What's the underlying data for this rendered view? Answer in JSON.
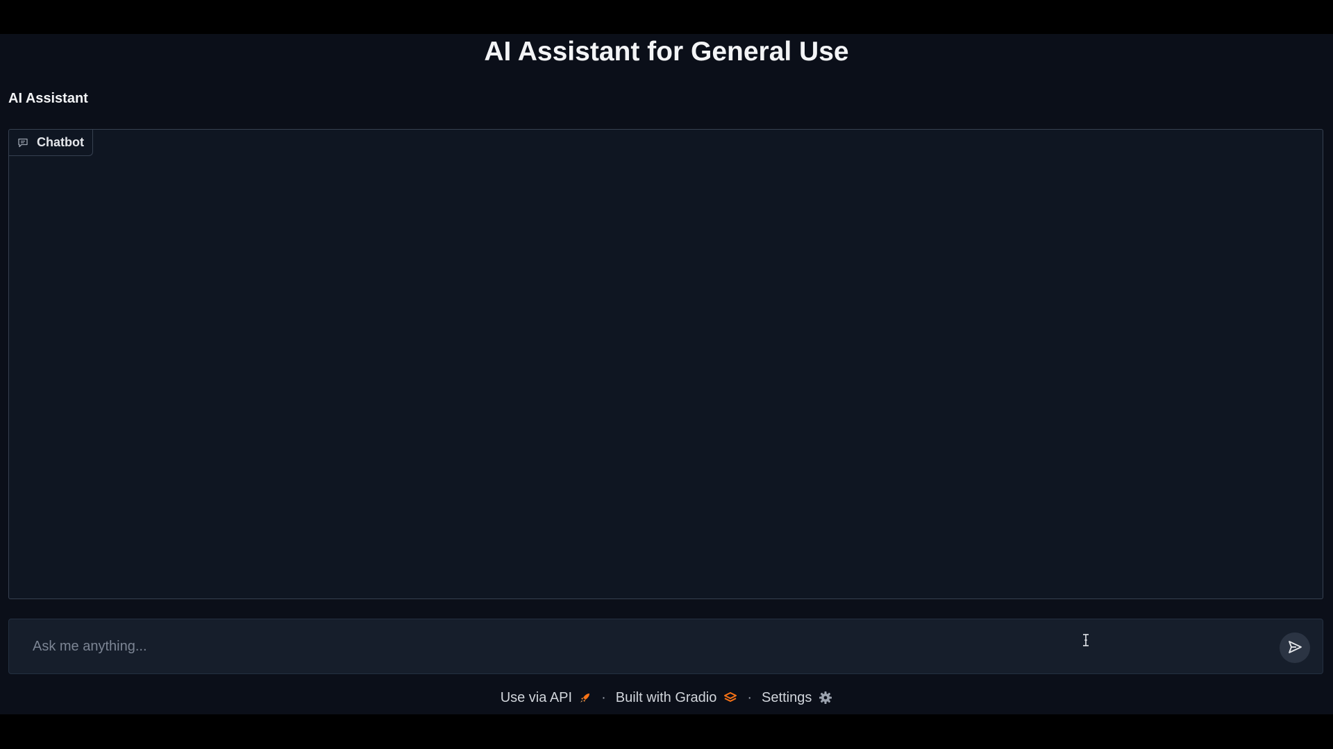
{
  "header": {
    "title": "AI Assistant for General Use"
  },
  "section": {
    "label": "AI Assistant"
  },
  "chatbot": {
    "badge_label": "Chatbot",
    "badge_icon": "chat-icon"
  },
  "input": {
    "placeholder": "Ask me anything...",
    "value": "",
    "send_icon": "send-icon"
  },
  "footer": {
    "api_label": "Use via API",
    "api_icon": "rocket-icon",
    "separator": "·",
    "gradio_label": "Built with Gradio",
    "gradio_icon": "gradio-logo-icon",
    "settings_label": "Settings",
    "settings_icon": "gear-icon"
  },
  "colors": {
    "background": "#0b0f19",
    "panel": "#0f1622",
    "border": "#374151",
    "accent_orange": "#f97316"
  }
}
